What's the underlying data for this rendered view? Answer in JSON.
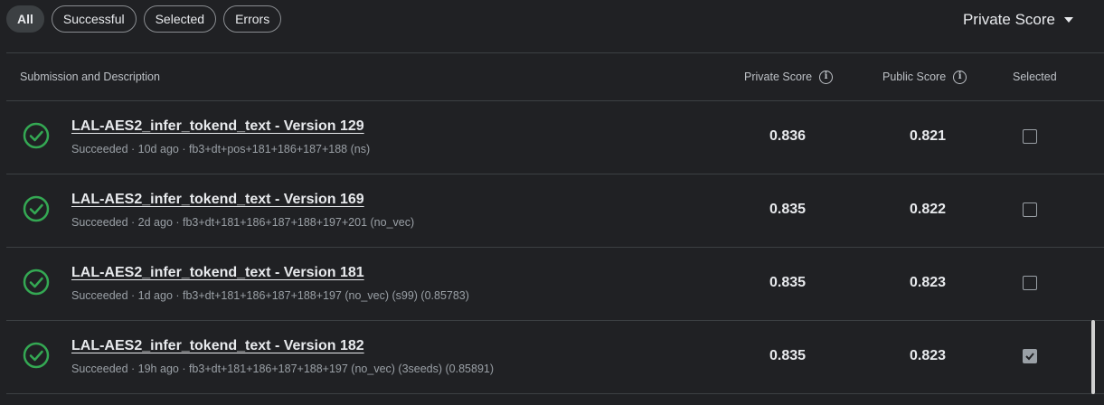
{
  "filters": [
    "All",
    "Successful",
    "Selected",
    "Errors"
  ],
  "active_filter": "All",
  "sort": {
    "label": "Private Score"
  },
  "columns": {
    "submission": "Submission and Description",
    "private": "Private Score",
    "public": "Public Score",
    "selected": "Selected"
  },
  "rows": [
    {
      "title": "LAL-AES2_infer_tokend_text - Version 129",
      "meta": "Succeeded · 10d ago · fb3+dt+pos+181+186+187+188 (ns)",
      "private": "0.836",
      "public": "0.821",
      "selected": false
    },
    {
      "title": "LAL-AES2_infer_tokend_text - Version 169",
      "meta": "Succeeded · 2d ago · fb3+dt+181+186+187+188+197+201 (no_vec)",
      "private": "0.835",
      "public": "0.822",
      "selected": false
    },
    {
      "title": "LAL-AES2_infer_tokend_text - Version 181",
      "meta": "Succeeded · 1d ago · fb3+dt+181+186+187+188+197 (no_vec) (s99) (0.85783)",
      "private": "0.835",
      "public": "0.823",
      "selected": false
    },
    {
      "title": "LAL-AES2_infer_tokend_text - Version 182",
      "meta": "Succeeded · 19h ago · fb3+dt+181+186+187+188+197 (no_vec) (3seeds) (0.85891)",
      "private": "0.835",
      "public": "0.823",
      "selected": true
    }
  ],
  "colors": {
    "success": "#34a853",
    "background": "#202124"
  }
}
